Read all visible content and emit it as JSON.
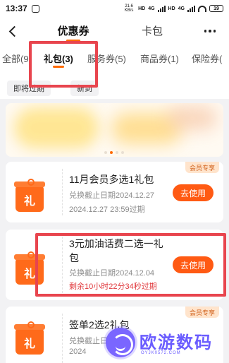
{
  "status_bar": {
    "time": "13:37",
    "net_speed_value": "21.6",
    "net_speed_unit": "KB/s",
    "network_tags": [
      "HD",
      "4G",
      "HD",
      "4G"
    ],
    "battery": "19"
  },
  "header": {
    "tabs": [
      {
        "label": "优惠券",
        "active": true
      },
      {
        "label": "卡包",
        "active": false
      }
    ]
  },
  "category_tabs": [
    {
      "label": "全部(9",
      "active": false
    },
    {
      "label": "礼包(3)",
      "active": true
    },
    {
      "label": "服务券(5)",
      "active": false
    },
    {
      "label": "商品券(1)",
      "active": false
    },
    {
      "label": "保险券(",
      "active": false
    }
  ],
  "filters": [
    {
      "label": "即将过期"
    },
    {
      "label": "新到"
    }
  ],
  "coupons": [
    {
      "title": "11月会员多选1礼包",
      "badge": "会员专享",
      "icon_text": "礼",
      "deadline": "兑换截止日期2024.12.27",
      "expire": "2024.12.27 23:59过期",
      "button": "去使用"
    },
    {
      "title": "3元加油话费二选一礼包",
      "icon_text": "礼",
      "deadline": "兑换截止日期2024.12.04",
      "countdown": "剩余10小时22分34秒过期",
      "button": "去使用"
    },
    {
      "title": "签单2选2礼包",
      "badge": "会员专享",
      "icon_text": "礼",
      "deadline": "兑换截止日期",
      "expire": "2024"
    }
  ],
  "watermark": {
    "text": "欧游数码",
    "domain": "OYJK0572.COM"
  },
  "colors": {
    "accent": "#ff6a00",
    "button": "#ff5a13",
    "countdown": "#e0373b",
    "annotation": "#e8454e",
    "badge_bg": "#ffe4cc"
  }
}
